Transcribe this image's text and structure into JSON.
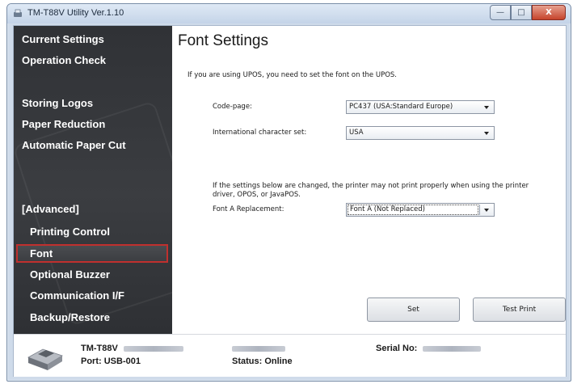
{
  "window": {
    "title": "TM-T88V Utility Ver.1.10",
    "buttons": {
      "minimize": "—",
      "maximize": "□",
      "close": "X"
    }
  },
  "sidebar": {
    "items": [
      {
        "label": "Current Settings"
      },
      {
        "label": "Operation Check"
      },
      {
        "label": "Storing Logos"
      },
      {
        "label": "Paper Reduction"
      },
      {
        "label": "Automatic Paper Cut"
      },
      {
        "label": "[Advanced]"
      },
      {
        "label": "Printing Control"
      },
      {
        "label": "Font",
        "selected": true
      },
      {
        "label": "Optional Buzzer"
      },
      {
        "label": "Communication I/F"
      },
      {
        "label": "Backup/Restore"
      }
    ]
  },
  "main": {
    "title": "Font Settings",
    "info": "If you are using UPOS, you need to set the font on the UPOS.",
    "code_page": {
      "label": "Code-page:",
      "value": "PC437 (USA:Standard Europe)"
    },
    "intl_charset": {
      "label": "International character set:",
      "value": "USA"
    },
    "warning": "If the settings below are changed, the printer may not print properly when using the printer driver, OPOS, or JavaPOS.",
    "font_a": {
      "label": "Font A Replacement:",
      "value": "Font A (Not Replaced)"
    },
    "buttons": {
      "set": "Set",
      "test_print": "Test Print"
    }
  },
  "footer": {
    "model": "TM-T88V",
    "port": "Port: USB-001",
    "status": "Status: Online",
    "serial_label": "Serial No:"
  },
  "colors": {
    "sidebar_bg": "#34363a",
    "selected_border": "#c0302e",
    "close_button": "#c6442c"
  }
}
